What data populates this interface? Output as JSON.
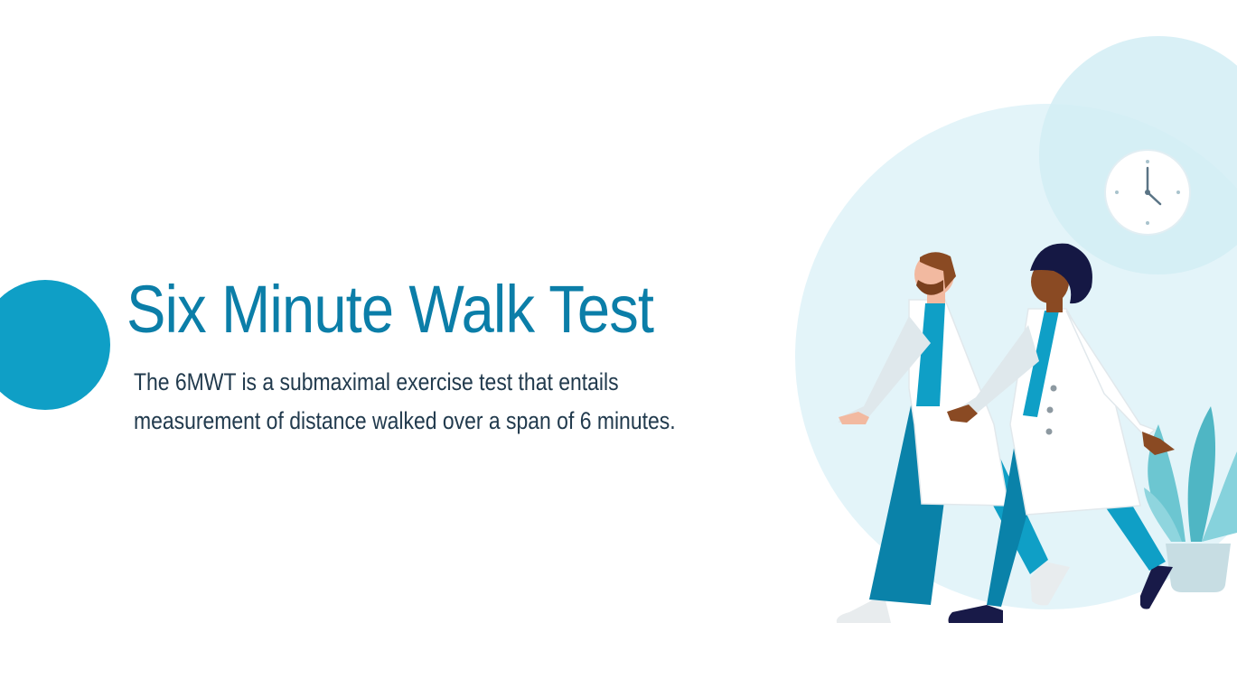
{
  "slide": {
    "title": "Six Minute Walk Test",
    "description_lines": [
      "The 6MWT is a submaximal exercise test that entails",
      "measurement of distance walked over a span of 6 minutes."
    ]
  },
  "colors": {
    "accent": "#0f9fc6",
    "title": "#0b7ea8",
    "body_text": "#213a4d",
    "backdrop": "#e3f4f9"
  },
  "illustration": {
    "icons": [
      "clock-icon",
      "plant-icon",
      "walking-doctor-man",
      "walking-doctor-woman"
    ]
  }
}
